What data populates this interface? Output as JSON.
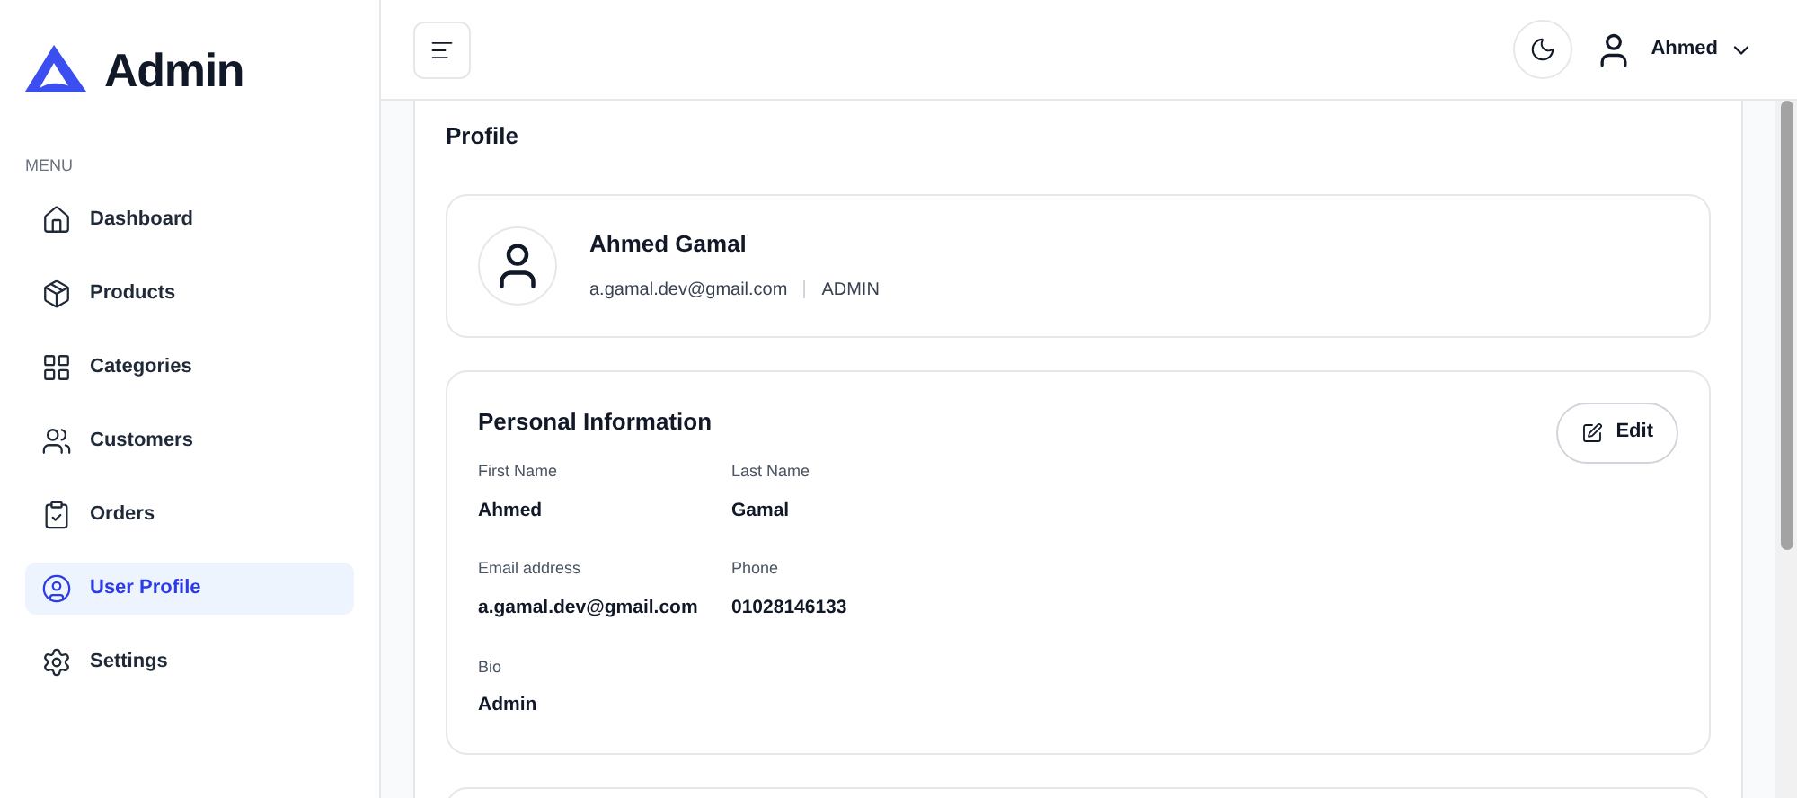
{
  "brand": {
    "name": "Admin"
  },
  "sidebar": {
    "section": "MENU",
    "items": [
      {
        "label": "Dashboard",
        "selected": false
      },
      {
        "label": "Products",
        "selected": false
      },
      {
        "label": "Categories",
        "selected": false
      },
      {
        "label": "Customers",
        "selected": false
      },
      {
        "label": "Orders",
        "selected": false
      },
      {
        "label": "User Profile",
        "selected": true
      },
      {
        "label": "Settings",
        "selected": false
      }
    ]
  },
  "header": {
    "user": "Ahmed"
  },
  "page": {
    "title": "Profile"
  },
  "profile_card": {
    "name": "Ahmed Gamal",
    "email": "a.gamal.dev@gmail.com",
    "role": "ADMIN"
  },
  "personal_info": {
    "title": "Personal Information",
    "edit": "Edit",
    "fields": [
      {
        "label": "First Name",
        "value": "Ahmed"
      },
      {
        "label": "Last Name",
        "value": "Gamal"
      },
      {
        "label": "Email address",
        "value": "a.gamal.dev@gmail.com"
      },
      {
        "label": "Phone",
        "value": "01028146133"
      },
      {
        "label": "Bio",
        "value": "Admin"
      }
    ]
  }
}
